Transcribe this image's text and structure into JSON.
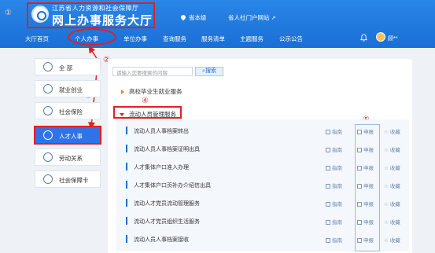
{
  "header": {
    "annotation": "①",
    "org_name": "江苏省人力资源和社会保障厅",
    "site_title": "网上办事服务大厅",
    "location": "省本级",
    "portal_link": "省人社门户网站",
    "portal_icon": "external-link-icon",
    "username": "顾**"
  },
  "nav": {
    "items": [
      "大厅首页",
      "个人办事",
      "单位办事",
      "查询服务",
      "服务清单",
      "主题服务",
      "公示公告"
    ],
    "active_index": 1
  },
  "annotations": {
    "n2": "②",
    "n3": "③",
    "n4": "④",
    "n5": "⑤"
  },
  "sidebar": {
    "items": [
      {
        "label": "全 部",
        "icon": "grid-icon"
      },
      {
        "label": "就业创业",
        "icon": "briefcase-icon"
      },
      {
        "label": "社会保险",
        "icon": "umbrella-icon"
      },
      {
        "label": "人才人事",
        "icon": "people-icon"
      },
      {
        "label": "劳动关系",
        "icon": "handshake-icon"
      },
      {
        "label": "社会保障卡",
        "icon": "card-icon"
      }
    ],
    "active_index": 3
  },
  "search": {
    "placeholder": "请输入您要搜索的内容",
    "button_label": "搜索"
  },
  "categories": [
    {
      "label": "高校毕业生就业服务",
      "expanded": false
    },
    {
      "label": "流动人员管理服务",
      "expanded": true
    }
  ],
  "services": [
    {
      "name": "流动人员人事档案转出"
    },
    {
      "name": "流动人员人事档案证明出具"
    },
    {
      "name": "人才集体户口准入办理"
    },
    {
      "name": "人才集体户口页补办介绍信出具"
    },
    {
      "name": "流动人才党员流动管理服务"
    },
    {
      "name": "流动人才党员组织生活服务"
    },
    {
      "name": "流动人员人事档案接收"
    }
  ],
  "service_actions": {
    "guide": "指南",
    "apply": "申报",
    "favorite": "收藏"
  },
  "colors": {
    "header_blue": "#1a6fd6",
    "annotation_red": "#e02020",
    "active_blue": "#2e74e8"
  }
}
